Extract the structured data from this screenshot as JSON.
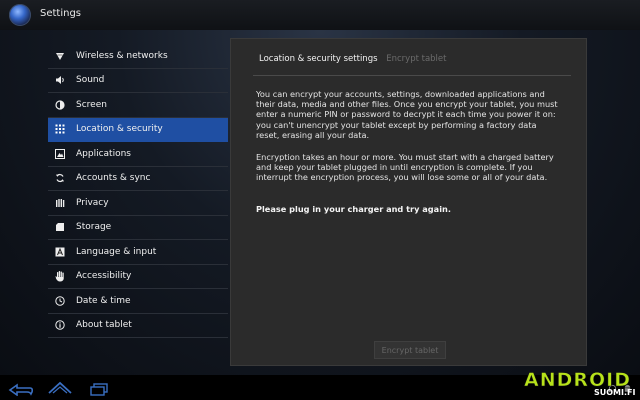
{
  "titlebar": {
    "title": "Settings"
  },
  "sidebar": {
    "items": [
      {
        "label": "Wireless & networks",
        "icon": "wifi-icon"
      },
      {
        "label": "Sound",
        "icon": "speaker-icon"
      },
      {
        "label": "Screen",
        "icon": "brightness-icon"
      },
      {
        "label": "Location & security",
        "icon": "grid-icon",
        "active": true
      },
      {
        "label": "Applications",
        "icon": "applications-icon"
      },
      {
        "label": "Accounts & sync",
        "icon": "sync-icon"
      },
      {
        "label": "Privacy",
        "icon": "privacy-icon"
      },
      {
        "label": "Storage",
        "icon": "storage-icon"
      },
      {
        "label": "Language & input",
        "icon": "language-icon"
      },
      {
        "label": "Accessibility",
        "icon": "hand-icon"
      },
      {
        "label": "Date & time",
        "icon": "clock-icon"
      },
      {
        "label": "About tablet",
        "icon": "info-icon"
      }
    ]
  },
  "panel": {
    "breadcrumb_1": "Location & security settings",
    "breadcrumb_2": "Encrypt tablet",
    "paragraph_1": "You can encrypt your accounts, settings, downloaded applications and their data, media and other files. Once you encrypt your tablet, you must enter a numeric PIN or password to decrypt it each time you power it on: you can't unencrypt your tablet except by performing a factory data reset, erasing all your data.",
    "paragraph_2": "Encryption takes an hour or more. You must start with a charged battery and keep your tablet plugged in until encryption is complete. If you interrupt the encryption process, you will lose some or all of your data.",
    "paragraph_3": "Please plug in your charger and try again.",
    "button_label": "Encrypt tablet"
  },
  "navbar": {
    "icons": [
      "back-icon",
      "home-icon",
      "recent-apps-icon",
      "headphones-icon",
      "android-icon"
    ]
  },
  "watermark": {
    "big": "ANDROID",
    "small": "SUOMI.FI"
  },
  "colors": {
    "active_item": "#1f4fa3",
    "panel_bg": "#2b2b2b",
    "watermark": "#b7e21a"
  }
}
